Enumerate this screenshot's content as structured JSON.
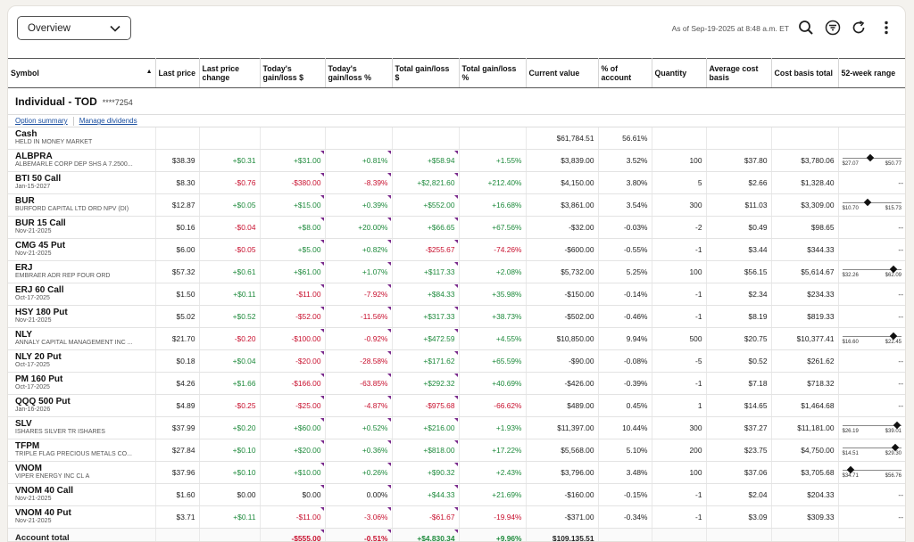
{
  "toolbar": {
    "view_label": "Overview",
    "as_of": "As of Sep-19-2025 at 8:48 a.m. ET",
    "icons": [
      "search-icon",
      "filter-icon",
      "refresh-icon",
      "more-icon"
    ]
  },
  "columns": [
    "Symbol",
    "Last price",
    "Last price change",
    "Today's gain/loss $",
    "Today's gain/loss %",
    "Total gain/loss $",
    "Total gain/loss %",
    "Current value",
    "% of account",
    "Quantity",
    "Average cost basis",
    "Cost basis total",
    "52-week range"
  ],
  "account": {
    "name": "Individual - TOD",
    "number": "****7254",
    "links": [
      "Option summary",
      "Manage dividends"
    ]
  },
  "cash": {
    "symbol": "Cash",
    "desc": "HELD IN MONEY MARKET",
    "current_value": "$61,784.51",
    "pct_account": "56.61%"
  },
  "rows": [
    {
      "symbol": "ALBPRA",
      "desc": "ALBEMARLE CORP DEP SHS A 7.2500...",
      "last": "$38.39",
      "chg": "+$0.31",
      "tgl": "+$31.00",
      "tglp": "+0.81%",
      "totgl": "+$58.94",
      "totglp": "+1.55%",
      "val": "$3,839.00",
      "pct": "3.52%",
      "qty": "100",
      "avg": "$37.80",
      "cost": "$3,780.06",
      "range": {
        "low": "$27.07",
        "high": "$50.77",
        "pos": 0.47
      }
    },
    {
      "symbol": "BTI 50 Call",
      "desc": "Jan-15-2027",
      "last": "$8.30",
      "chg": "-$0.76",
      "tgl": "-$380.00",
      "tglp": "-8.39%",
      "totgl": "+$2,821.60",
      "totglp": "+212.40%",
      "val": "$4,150.00",
      "pct": "3.80%",
      "qty": "5",
      "avg": "$2.66",
      "cost": "$1,328.40",
      "range": null
    },
    {
      "symbol": "BUR",
      "desc": "BURFORD CAPITAL LTD ORD NPV (DI)",
      "last": "$12.87",
      "chg": "+$0.05",
      "tgl": "+$15.00",
      "tglp": "+0.39%",
      "totgl": "+$552.00",
      "totglp": "+16.68%",
      "val": "$3,861.00",
      "pct": "3.54%",
      "qty": "300",
      "avg": "$11.03",
      "cost": "$3,309.00",
      "range": {
        "low": "$10.70",
        "high": "$15.73",
        "pos": 0.43
      }
    },
    {
      "symbol": "BUR 15 Call",
      "desc": "Nov-21-2025",
      "last": "$0.16",
      "chg": "-$0.04",
      "tgl": "+$8.00",
      "tglp": "+20.00%",
      "totgl": "+$66.65",
      "totglp": "+67.56%",
      "val": "-$32.00",
      "pct": "-0.03%",
      "qty": "-2",
      "avg": "$0.49",
      "cost": "$98.65",
      "range": null
    },
    {
      "symbol": "CMG 45 Put",
      "desc": "Nov-21-2025",
      "last": "$6.00",
      "chg": "-$0.05",
      "tgl": "+$5.00",
      "tglp": "+0.82%",
      "totgl": "-$255.67",
      "totglp": "-74.26%",
      "val": "-$600.00",
      "pct": "-0.55%",
      "qty": "-1",
      "avg": "$3.44",
      "cost": "$344.33",
      "range": null
    },
    {
      "symbol": "ERJ",
      "desc": "EMBRAER ADR REP FOUR ORD",
      "last": "$57.32",
      "chg": "+$0.61",
      "tgl": "+$61.00",
      "tglp": "+1.07%",
      "totgl": "+$117.33",
      "totglp": "+2.08%",
      "val": "$5,732.00",
      "pct": "5.25%",
      "qty": "100",
      "avg": "$56.15",
      "cost": "$5,614.67",
      "range": {
        "low": "$32.26",
        "high": "$62.09",
        "pos": 0.86
      }
    },
    {
      "symbol": "ERJ 60 Call",
      "desc": "Oct-17-2025",
      "last": "$1.50",
      "chg": "+$0.11",
      "tgl": "-$11.00",
      "tglp": "-7.92%",
      "totgl": "+$84.33",
      "totglp": "+35.98%",
      "val": "-$150.00",
      "pct": "-0.14%",
      "qty": "-1",
      "avg": "$2.34",
      "cost": "$234.33",
      "range": null
    },
    {
      "symbol": "HSY 180 Put",
      "desc": "Nov-21-2025",
      "last": "$5.02",
      "chg": "+$0.52",
      "tgl": "-$52.00",
      "tglp": "-11.56%",
      "totgl": "+$317.33",
      "totglp": "+38.73%",
      "val": "-$502.00",
      "pct": "-0.46%",
      "qty": "-1",
      "avg": "$8.19",
      "cost": "$819.33",
      "range": null
    },
    {
      "symbol": "NLY",
      "desc": "ANNALY CAPITAL MANAGEMENT INC ...",
      "last": "$21.70",
      "chg": "-$0.20",
      "tgl": "-$100.00",
      "tglp": "-0.92%",
      "totgl": "+$472.59",
      "totglp": "+4.55%",
      "val": "$10,850.00",
      "pct": "9.94%",
      "qty": "500",
      "avg": "$20.75",
      "cost": "$10,377.41",
      "range": {
        "low": "$16.60",
        "high": "$22.45",
        "pos": 0.87
      }
    },
    {
      "symbol": "NLY 20 Put",
      "desc": "Oct-17-2025",
      "last": "$0.18",
      "chg": "+$0.04",
      "tgl": "-$20.00",
      "tglp": "-28.58%",
      "totgl": "+$171.62",
      "totglp": "+65.59%",
      "val": "-$90.00",
      "pct": "-0.08%",
      "qty": "-5",
      "avg": "$0.52",
      "cost": "$261.62",
      "range": null
    },
    {
      "symbol": "PM 160 Put",
      "desc": "Oct-17-2025",
      "last": "$4.26",
      "chg": "+$1.66",
      "tgl": "-$166.00",
      "tglp": "-63.85%",
      "totgl": "+$292.32",
      "totglp": "+40.69%",
      "val": "-$426.00",
      "pct": "-0.39%",
      "qty": "-1",
      "avg": "$7.18",
      "cost": "$718.32",
      "range": null
    },
    {
      "symbol": "QQQ 500 Put",
      "desc": "Jan-16-2026",
      "last": "$4.89",
      "chg": "-$0.25",
      "tgl": "-$25.00",
      "tglp": "-4.87%",
      "totgl": "-$975.68",
      "totglp": "-66.62%",
      "val": "$489.00",
      "pct": "0.45%",
      "qty": "1",
      "avg": "$14.65",
      "cost": "$1,464.68",
      "range": null
    },
    {
      "symbol": "SLV",
      "desc": "ISHARES SILVER TR ISHARES",
      "last": "$37.99",
      "chg": "+$0.20",
      "tgl": "+$60.00",
      "tglp": "+0.52%",
      "totgl": "+$216.00",
      "totglp": "+1.93%",
      "val": "$11,397.00",
      "pct": "10.44%",
      "qty": "300",
      "avg": "$37.27",
      "cost": "$11,181.00",
      "range": {
        "low": "$26.19",
        "high": "$39.01",
        "pos": 0.92
      }
    },
    {
      "symbol": "TFPM",
      "desc": "TRIPLE FLAG PRECIOUS METALS CO...",
      "last": "$27.84",
      "chg": "+$0.10",
      "tgl": "+$20.00",
      "tglp": "+0.36%",
      "totgl": "+$818.00",
      "totglp": "+17.22%",
      "val": "$5,568.00",
      "pct": "5.10%",
      "qty": "200",
      "avg": "$23.75",
      "cost": "$4,750.00",
      "range": {
        "low": "$14.51",
        "high": "$29.30",
        "pos": 0.9
      }
    },
    {
      "symbol": "VNOM",
      "desc": "VIPER ENERGY INC CL A",
      "last": "$37.96",
      "chg": "+$0.10",
      "tgl": "+$10.00",
      "tglp": "+0.26%",
      "totgl": "+$90.32",
      "totglp": "+2.43%",
      "val": "$3,796.00",
      "pct": "3.48%",
      "qty": "100",
      "avg": "$37.06",
      "cost": "$3,705.68",
      "range": {
        "low": "$34.71",
        "high": "$56.76",
        "pos": 0.15
      }
    },
    {
      "symbol": "VNOM 40 Call",
      "desc": "Nov-21-2025",
      "last": "$1.60",
      "chg": "$0.00",
      "tgl": "$0.00",
      "tglp": "0.00%",
      "totgl": "+$44.33",
      "totglp": "+21.69%",
      "val": "-$160.00",
      "pct": "-0.15%",
      "qty": "-1",
      "avg": "$2.04",
      "cost": "$204.33",
      "range": null
    },
    {
      "symbol": "VNOM 40 Put",
      "desc": "Nov-21-2025",
      "last": "$3.71",
      "chg": "+$0.11",
      "tgl": "-$11.00",
      "tglp": "-3.06%",
      "totgl": "-$61.67",
      "totglp": "-19.94%",
      "val": "-$371.00",
      "pct": "-0.34%",
      "qty": "-1",
      "avg": "$3.09",
      "cost": "$309.33",
      "range": null
    }
  ],
  "total": {
    "label": "Account total",
    "tgl": "-$555.00",
    "tglp": "-0.51%",
    "totgl": "+$4,830.34",
    "totglp": "+9.96%",
    "val": "$109,135.51"
  },
  "colors": {
    "positive": "#1e8a3c",
    "negative": "#c8102e",
    "link": "#1b4fa0",
    "flag": "#7a2a8c"
  }
}
